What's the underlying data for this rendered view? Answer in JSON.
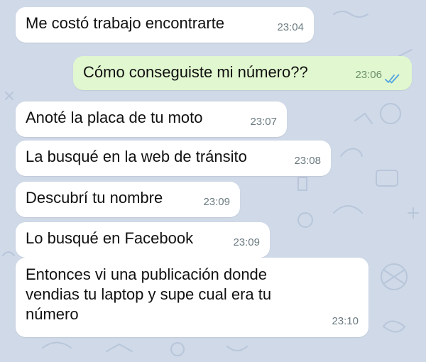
{
  "messages": [
    {
      "text": "Me costó trabajo encontrarte",
      "time": "23:04",
      "direction": "incoming"
    },
    {
      "text": "Cómo conseguiste mi número??",
      "time": "23:06",
      "direction": "outgoing",
      "status": "read"
    },
    {
      "text": "Anoté la placa de tu moto",
      "time": "23:07",
      "direction": "incoming"
    },
    {
      "text": "La busqué en la web de tránsito",
      "time": "23:08",
      "direction": "incoming"
    },
    {
      "text": "Descubrí tu nombre",
      "time": "23:09",
      "direction": "incoming"
    },
    {
      "text": "Lo busqué en Facebook",
      "time": "23:09",
      "direction": "incoming"
    },
    {
      "text": "Entonces vi una publicación donde vendias tu laptop y supe cual era tu número",
      "time": "23:10",
      "direction": "incoming"
    }
  ],
  "colors": {
    "background": "#cfd9e8",
    "incoming_bubble": "#ffffff",
    "outgoing_bubble": "#e1f7cf",
    "read_ticks": "#4fa3e0"
  },
  "icons": {
    "read_status": "double-check-icon",
    "wallpaper": "doodle-pattern"
  }
}
